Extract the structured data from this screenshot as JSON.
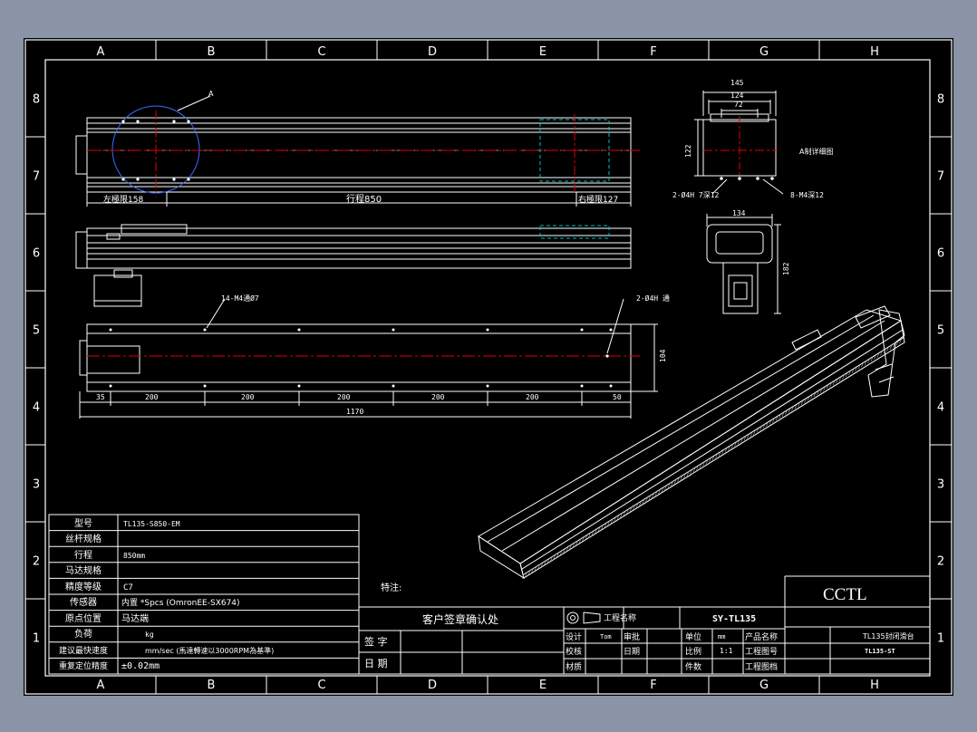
{
  "border": {
    "cols": [
      "A",
      "B",
      "C",
      "D",
      "E",
      "F",
      "G",
      "H"
    ],
    "rows": [
      "8",
      "7",
      "6",
      "5",
      "4",
      "3",
      "2",
      "1"
    ]
  },
  "top_view": {
    "callout": "A",
    "left_limit": "左極限158",
    "stroke": "行程850",
    "right_limit": "右極限127"
  },
  "end_view": {
    "dim_width": "145",
    "dim_inner": "124",
    "dim_slot": "72",
    "dim_height": "122",
    "note_right": "A制详细图",
    "note_holes_left": "2-Ø4H 7深12",
    "note_holes_right": "8-M4深12"
  },
  "motor_end_view": {
    "dim_width": "134",
    "dim_height": "182"
  },
  "bottom_view": {
    "note_left": "14-M4通Ø7",
    "note_right": "2-Ø4H 通",
    "dim_height": "104",
    "dims": [
      "35",
      "200",
      "200",
      "200",
      "200",
      "200",
      "50"
    ],
    "total": "1170"
  },
  "spec_table": {
    "rows": [
      {
        "label": "型号",
        "value": "TL135-S850-EM"
      },
      {
        "label": "丝杆规格",
        "value": ""
      },
      {
        "label": "行程",
        "value": "850mm"
      },
      {
        "label": "马达规格",
        "value": ""
      },
      {
        "label": "精度等级",
        "value": "C7"
      },
      {
        "label": "传感器",
        "value": "内置 *Spcs (OmronEE-SX674)"
      },
      {
        "label": "原点位置",
        "value": "马达端"
      },
      {
        "label": "负荷",
        "value": "kg"
      },
      {
        "label": "建议最快速度",
        "value": "mm/sec (馬達轉速以3000RPM為基準)"
      },
      {
        "label": "重复定位精度",
        "value": "±0.02mm"
      }
    ]
  },
  "notes_label": "特注:",
  "signoff": {
    "title": "客户签章确认处",
    "sign": "签 字",
    "date": "日 期"
  },
  "title_block": {
    "company_label": "工程名称",
    "drawing_code": "SY-TL135",
    "design": "设计",
    "designer": "Tom",
    "approve": "审批",
    "check": "校核",
    "date": "日期",
    "material": "材质",
    "unit": "单位",
    "unit_value": "mm",
    "scale": "比例",
    "scale_value": "1:1",
    "qty": "件数",
    "product_name_label": "产品名称",
    "product_name": "TL135封闭滑台",
    "drawing_no_label": "工程图号",
    "drawing_no": "TL135-ST",
    "drawing_file_label": "工程图档",
    "brand": "CCTL"
  }
}
